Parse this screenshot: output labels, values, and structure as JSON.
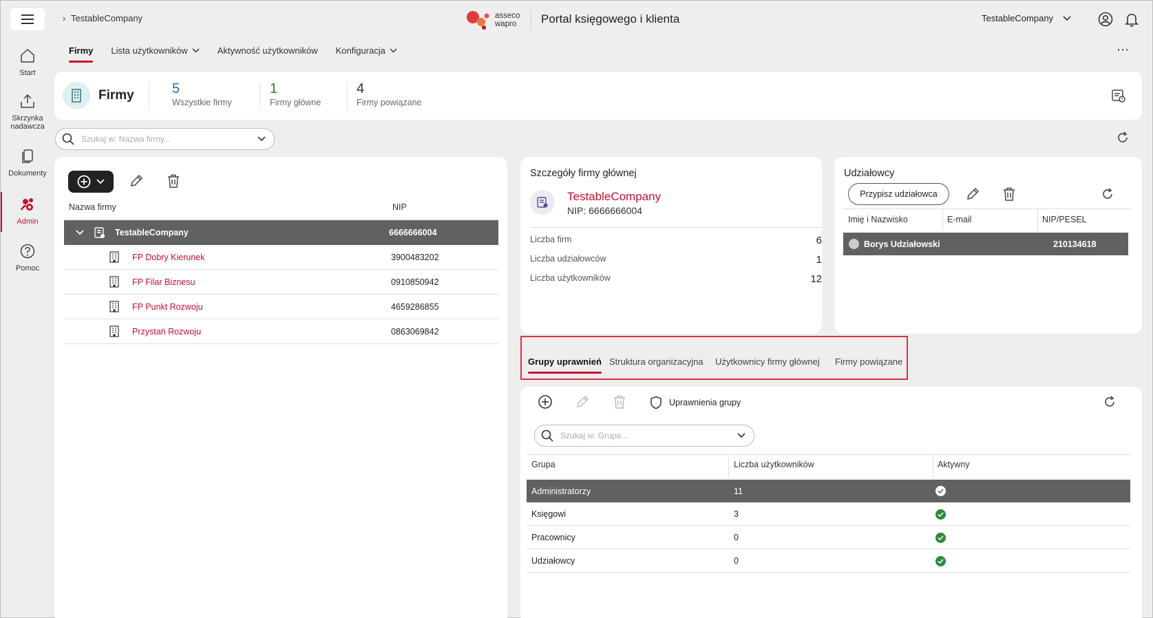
{
  "header": {
    "breadcrumb": "TestableCompany",
    "logo_line1": "asseco",
    "logo_line2": "wapro",
    "portal_title": "Portal księgowego i klienta",
    "company_selector": "TestableCompany"
  },
  "sidebar": {
    "items": [
      {
        "label": "Start",
        "icon": "home-icon"
      },
      {
        "label": "Skrzynka nadawcza",
        "icon": "outbox-icon"
      },
      {
        "label": "Dokumenty",
        "icon": "documents-icon"
      },
      {
        "label": "Admin",
        "icon": "admin-icon",
        "active": true
      },
      {
        "label": "Pomoc",
        "icon": "help-icon"
      }
    ]
  },
  "nav": {
    "tabs": [
      {
        "label": "Firmy",
        "active": true
      },
      {
        "label": "Lista użytkowników",
        "dropdown": true
      },
      {
        "label": "Aktywność użytkowników"
      },
      {
        "label": "Konfiguracja",
        "dropdown": true
      }
    ]
  },
  "summary": {
    "title": "Firmy",
    "stats": [
      {
        "value": "5",
        "label": "Wszystkie firmy",
        "color": "#1a6fb5"
      },
      {
        "value": "1",
        "label": "Firmy główne",
        "color": "#2e7d32"
      },
      {
        "value": "4",
        "label": "Firmy powiązane",
        "color": "#333333"
      }
    ]
  },
  "search_companies": {
    "placeholder": "Szukaj w: Nazwa firmy..."
  },
  "companies": {
    "columns": [
      "Nazwa firmy",
      "NIP"
    ],
    "rows": [
      {
        "name": "TestableCompany",
        "nip": "6666666004",
        "main": true
      },
      {
        "name": "FP Dobry Kierunek",
        "nip": "3900483202"
      },
      {
        "name": "FP Filar Biznesu",
        "nip": "0910850942"
      },
      {
        "name": "FP Punkt Rozwoju",
        "nip": "4659286855"
      },
      {
        "name": "Przystań Rozwoju",
        "nip": "0863069842"
      }
    ]
  },
  "details": {
    "title": "Szczegóły firmy głównej",
    "company_name": "TestableCompany",
    "nip": "NIP: 6666666004",
    "stats": [
      {
        "label": "Liczba firm",
        "value": "6"
      },
      {
        "label": "Liczba udziałowców",
        "value": "1"
      },
      {
        "label": "Liczba użytkowników",
        "value": "12"
      }
    ]
  },
  "shareholders": {
    "title": "Udziałowcy",
    "assign_button": "Przypisz udziałowca",
    "columns": [
      "Imię i Nazwisko",
      "E-mail",
      "NIP/PESEL"
    ],
    "rows": [
      {
        "name": "Borys Udziałowski",
        "email": "",
        "nip": "210134618"
      }
    ]
  },
  "subtabs": [
    {
      "label": "Grupy uprawnień",
      "active": true
    },
    {
      "label": "Struktura organizacyjna"
    },
    {
      "label": "Użytkownicy firmy głównej"
    },
    {
      "label": "Firmy powiązane"
    }
  ],
  "groups": {
    "permissions_button": "Uprawnienia grupy",
    "search_placeholder": "Szukaj w: Grupa...",
    "columns": [
      "Grupa",
      "Liczba użytkowników",
      "Aktywny"
    ],
    "rows": [
      {
        "name": "Administratorzy",
        "count": "11",
        "active": true
      },
      {
        "name": "Księgowi",
        "count": "3",
        "active": true
      },
      {
        "name": "Pracownicy",
        "count": "0",
        "active": true
      },
      {
        "name": "Udziałowcy",
        "count": "0",
        "active": true
      }
    ]
  },
  "colors": {
    "accent": "#c8102e",
    "selected_row": "#616161",
    "active_check": "#2e8b3a"
  }
}
